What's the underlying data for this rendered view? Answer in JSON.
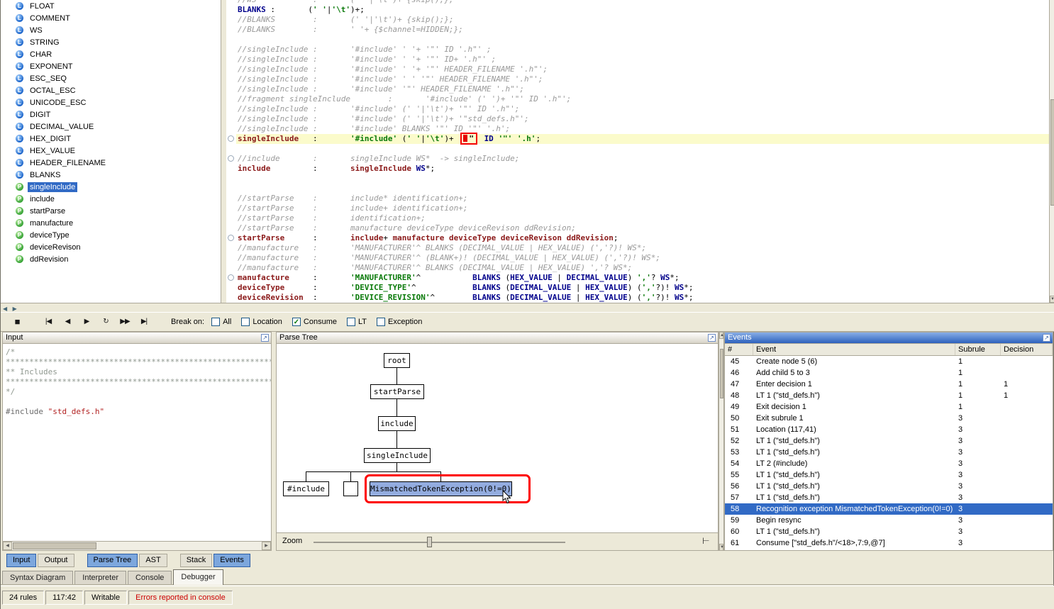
{
  "icons": {
    "detach": "↗",
    "stop": "■",
    "go_to_start": "|◀",
    "step_back": "◀",
    "step_forward": "▶",
    "rewind": "↻",
    "fast_forward": "▶▶",
    "go_to_end": "▶|",
    "check": "✓",
    "scroll_up": "▲",
    "scroll_down": "▼",
    "scroll_left": "◀",
    "scroll_right": "▶",
    "collapse_left": "◀",
    "collapse_right": "▶",
    "tree_layout": "⊢"
  },
  "rules_panel": {
    "items": [
      {
        "name": "FLOAT",
        "kind": "lexer"
      },
      {
        "name": "COMMENT",
        "kind": "lexer"
      },
      {
        "name": "WS",
        "kind": "lexer"
      },
      {
        "name": "STRING",
        "kind": "lexer"
      },
      {
        "name": "CHAR",
        "kind": "lexer"
      },
      {
        "name": "EXPONENT",
        "kind": "lexer"
      },
      {
        "name": "ESC_SEQ",
        "kind": "lexer"
      },
      {
        "name": "OCTAL_ESC",
        "kind": "lexer"
      },
      {
        "name": "UNICODE_ESC",
        "kind": "lexer"
      },
      {
        "name": "DIGIT",
        "kind": "lexer"
      },
      {
        "name": "DECIMAL_VALUE",
        "kind": "lexer"
      },
      {
        "name": "HEX_DIGIT",
        "kind": "lexer"
      },
      {
        "name": "HEX_VALUE",
        "kind": "lexer"
      },
      {
        "name": "HEADER_FILENAME",
        "kind": "lexer"
      },
      {
        "name": "BLANKS",
        "kind": "lexer"
      },
      {
        "name": "singleInclude",
        "kind": "parser",
        "selected": true
      },
      {
        "name": "include",
        "kind": "parser"
      },
      {
        "name": "startParse",
        "kind": "parser"
      },
      {
        "name": "manufacture",
        "kind": "parser"
      },
      {
        "name": "deviceType",
        "kind": "parser"
      },
      {
        "name": "deviceRevison",
        "kind": "parser"
      },
      {
        "name": "ddRevision",
        "kind": "parser"
      }
    ]
  },
  "editor": {
    "lines": [
      {
        "segs": [
          [
            "cmt",
            "//WS            :       (' '|'\\t')+ {skip();};"
          ]
        ]
      },
      {
        "segs": [
          [
            "tok",
            "BLANKS"
          ],
          [
            "pln",
            " :       ("
          ],
          [
            "lit",
            "' '"
          ],
          [
            "pln",
            "|"
          ],
          [
            "lit",
            "'\\t'"
          ],
          [
            "pln",
            ")+;"
          ]
        ]
      },
      {
        "segs": [
          [
            "cmt",
            "//BLANKS        :       (' '|'\\t')+ {skip();};"
          ]
        ]
      },
      {
        "segs": [
          [
            "cmt",
            "//BLANKS        :       ' '+ {$channel=HIDDEN;};"
          ]
        ]
      },
      {
        "segs": []
      },
      {
        "segs": [
          [
            "cmt",
            "//singleInclude :       '#include' ' '+ '\"' ID '.h\"' ;"
          ]
        ]
      },
      {
        "segs": [
          [
            "cmt",
            "//singleInclude :       '#include' ' '+ '\"' ID+ '.h\"' ;"
          ]
        ]
      },
      {
        "segs": [
          [
            "cmt",
            "//singleInclude :       '#include' ' '+ '\"' HEADER_FILENAME '.h\"';"
          ]
        ]
      },
      {
        "segs": [
          [
            "cmt",
            "//singleInclude :       '#include' ' ' '\"' HEADER_FILENAME '.h\"';"
          ]
        ]
      },
      {
        "segs": [
          [
            "cmt",
            "//singleInclude :       '#include' '\"' HEADER_FILENAME '.h\"';"
          ]
        ]
      },
      {
        "segs": [
          [
            "cmt",
            "//fragment singleInclude        :       '#include' (' ')+ '\"' ID '.h\"';"
          ]
        ]
      },
      {
        "segs": [
          [
            "cmt",
            "//singleInclude :       '#include' (' '|'\\t')+ '\"' ID '.h\"';"
          ]
        ]
      },
      {
        "segs": [
          [
            "cmt",
            "//singleInclude :       '#include' (' '|'\\t')+ '\"std_defs.h\"';"
          ]
        ]
      },
      {
        "segs": [
          [
            "cmt",
            "//singleInclude :       '#include' BLANKS '\"' ID '\"' '.h';"
          ]
        ]
      },
      {
        "current": true,
        "segs": [
          [
            "rule",
            "singleInclude"
          ],
          [
            "pln",
            "   :       "
          ],
          [
            "lit",
            "'#include'"
          ],
          [
            "pln",
            " ("
          ],
          [
            "lit",
            "' '"
          ],
          [
            "pln",
            "|"
          ],
          [
            "lit",
            "'\\t'"
          ],
          [
            "pln",
            ")+ "
          ],
          [
            "cur",
            "\""
          ],
          [
            "pln",
            " "
          ],
          [
            "tok",
            "ID"
          ],
          [
            "pln",
            " "
          ],
          [
            "lit",
            "'\"'"
          ],
          [
            "pln",
            " "
          ],
          [
            "lit",
            "'.h'"
          ],
          [
            "pln",
            ";"
          ]
        ]
      },
      {
        "segs": []
      },
      {
        "segs": [
          [
            "cmt",
            "//include       :       singleInclude WS*  -> singleInclude;"
          ]
        ]
      },
      {
        "segs": [
          [
            "rule",
            "include"
          ],
          [
            "pln",
            "         :       "
          ],
          [
            "rule",
            "singleInclude"
          ],
          [
            "pln",
            " "
          ],
          [
            "tok",
            "WS"
          ],
          [
            "pln",
            "*;"
          ]
        ]
      },
      {
        "segs": []
      },
      {
        "segs": []
      },
      {
        "segs": [
          [
            "cmt",
            "//startParse    :       include* identification+;"
          ]
        ]
      },
      {
        "segs": [
          [
            "cmt",
            "//startParse    :       include+ identification+;"
          ]
        ]
      },
      {
        "segs": [
          [
            "cmt",
            "//startParse    :       identification+;"
          ]
        ]
      },
      {
        "segs": [
          [
            "cmt",
            "//startParse    :       manufacture deviceType deviceRevison ddRevision;"
          ]
        ]
      },
      {
        "segs": [
          [
            "rule",
            "startParse"
          ],
          [
            "pln",
            "      :       "
          ],
          [
            "rule",
            "include"
          ],
          [
            "pln",
            "+ "
          ],
          [
            "rule",
            "manufacture"
          ],
          [
            "pln",
            " "
          ],
          [
            "rule",
            "deviceType"
          ],
          [
            "pln",
            " "
          ],
          [
            "rule",
            "deviceRevison"
          ],
          [
            "pln",
            " "
          ],
          [
            "rule",
            "ddRevision"
          ],
          [
            "pln",
            ";"
          ]
        ]
      },
      {
        "segs": [
          [
            "cmt",
            "//manufacture   :       'MANUFACTURER'^ BLANKS (DECIMAL_VALUE | HEX_VALUE) (','?)! WS*;"
          ]
        ]
      },
      {
        "segs": [
          [
            "cmt",
            "//manufacture   :       'MANUFACTURER'^ (BLANK+)! (DECIMAL_VALUE | HEX_VALUE) (','?)! WS*;"
          ]
        ]
      },
      {
        "segs": [
          [
            "cmt",
            "//manufacture   :       'MANUFACTURER'^ BLANKS (DECIMAL_VALUE | HEX_VALUE) ','? WS*;"
          ]
        ]
      },
      {
        "segs": [
          [
            "rule",
            "manufacture"
          ],
          [
            "pln",
            "     :       "
          ],
          [
            "lit",
            "'MANUFACTURER'"
          ],
          [
            "pln",
            "^           "
          ],
          [
            "tok",
            "BLANKS"
          ],
          [
            "pln",
            " ("
          ],
          [
            "tok",
            "HEX_VALUE"
          ],
          [
            "pln",
            " | "
          ],
          [
            "tok",
            "DECIMAL_VALUE"
          ],
          [
            "pln",
            ") "
          ],
          [
            "lit",
            "','"
          ],
          [
            "pln",
            "? "
          ],
          [
            "tok",
            "WS"
          ],
          [
            "pln",
            "*;"
          ]
        ]
      },
      {
        "segs": [
          [
            "rule",
            "deviceType"
          ],
          [
            "pln",
            "      :       "
          ],
          [
            "lit",
            "'DEVICE_TYPE'"
          ],
          [
            "pln",
            "^            "
          ],
          [
            "tok",
            "BLANKS"
          ],
          [
            "pln",
            " ("
          ],
          [
            "tok",
            "DECIMAL_VALUE"
          ],
          [
            "pln",
            " | "
          ],
          [
            "tok",
            "HEX_VALUE"
          ],
          [
            "pln",
            ") ("
          ],
          [
            "lit",
            "','"
          ],
          [
            "pln",
            "?)! "
          ],
          [
            "tok",
            "WS"
          ],
          [
            "pln",
            "*;"
          ]
        ]
      },
      {
        "segs": [
          [
            "rule",
            "deviceRevision"
          ],
          [
            "pln",
            "  :       "
          ],
          [
            "lit",
            "'DEVICE_REVISION'"
          ],
          [
            "pln",
            "^        "
          ],
          [
            "tok",
            "BLANKS"
          ],
          [
            "pln",
            " ("
          ],
          [
            "tok",
            "DECIMAL_VALUE"
          ],
          [
            "pln",
            " | "
          ],
          [
            "tok",
            "HEX_VALUE"
          ],
          [
            "pln",
            ") ("
          ],
          [
            "lit",
            "','"
          ],
          [
            "pln",
            "?)! "
          ],
          [
            "tok",
            "WS"
          ],
          [
            "pln",
            "*;"
          ]
        ]
      }
    ]
  },
  "toolbar": {
    "break_on_label": "Break on:",
    "buttons": [
      {
        "name": "stop",
        "icon": "stop"
      },
      {
        "name": "go-to-start",
        "icon": "go_to_start"
      },
      {
        "name": "step-back",
        "icon": "step_back"
      },
      {
        "name": "step-forward",
        "icon": "step_forward"
      },
      {
        "name": "rewind",
        "icon": "rewind"
      },
      {
        "name": "fast-forward",
        "icon": "fast_forward"
      },
      {
        "name": "go-to-end",
        "icon": "go_to_end"
      }
    ],
    "checkboxes": [
      {
        "label": "All",
        "checked": false
      },
      {
        "label": "Location",
        "checked": false
      },
      {
        "label": "Consume",
        "checked": true
      },
      {
        "label": "LT",
        "checked": false
      },
      {
        "label": "Exception",
        "checked": false
      }
    ]
  },
  "input_panel": {
    "title": "Input",
    "lines": [
      [
        [
          "icmt",
          "/*"
        ]
      ],
      [
        [
          "icmt",
          "**********************************************************************************************"
        ]
      ],
      [
        [
          "icmt",
          "** Includes"
        ]
      ],
      [
        [
          "icmt",
          "**********************************************************************************************"
        ]
      ],
      [
        [
          "icmt",
          "*/"
        ]
      ],
      [],
      [
        [
          "idir",
          "#include"
        ],
        [
          "ipln",
          " "
        ],
        [
          "istr",
          "\"std_defs.h\""
        ]
      ]
    ]
  },
  "parse_tree": {
    "title": "Parse Tree",
    "zoom_label": "Zoom",
    "nodes": {
      "root": "root",
      "start_parse": "startParse",
      "include": "include",
      "single_include": "singleInclude",
      "child_include_literal": "#include",
      "child_empty": "",
      "child_exception": "MismatchedTokenException(0!=0)"
    }
  },
  "events_panel": {
    "title": "Events",
    "columns": [
      "#",
      "Event",
      "Subrule",
      "Decision"
    ],
    "rows": [
      {
        "n": "45",
        "event": "Create node 5 (6)",
        "subrule": "1",
        "decision": ""
      },
      {
        "n": "46",
        "event": "Add child 5 to 3",
        "subrule": "1",
        "decision": ""
      },
      {
        "n": "47",
        "event": "Enter decision 1",
        "subrule": "1",
        "decision": "1"
      },
      {
        "n": "48",
        "event": "LT 1 (\"std_defs.h\")",
        "subrule": "1",
        "decision": "1"
      },
      {
        "n": "49",
        "event": "Exit decision 1",
        "subrule": "1",
        "decision": ""
      },
      {
        "n": "50",
        "event": "Exit subrule 1",
        "subrule": "3",
        "decision": ""
      },
      {
        "n": "51",
        "event": "Location (117,41)",
        "subrule": "3",
        "decision": ""
      },
      {
        "n": "52",
        "event": "LT 1 (\"std_defs.h\")",
        "subrule": "3",
        "decision": ""
      },
      {
        "n": "53",
        "event": "LT 1 (\"std_defs.h\")",
        "subrule": "3",
        "decision": ""
      },
      {
        "n": "54",
        "event": "LT 2 (#include)",
        "subrule": "3",
        "decision": ""
      },
      {
        "n": "55",
        "event": "LT 1 (\"std_defs.h\")",
        "subrule": "3",
        "decision": ""
      },
      {
        "n": "56",
        "event": "LT 1 (\"std_defs.h\")",
        "subrule": "3",
        "decision": ""
      },
      {
        "n": "57",
        "event": "LT 1 (\"std_defs.h\")",
        "subrule": "3",
        "decision": ""
      },
      {
        "n": "58",
        "event": "Recognition exception MismatchedTokenException(0!=0)",
        "subrule": "3",
        "decision": "",
        "selected": true
      },
      {
        "n": "59",
        "event": "Begin resync",
        "subrule": "3",
        "decision": ""
      },
      {
        "n": "60",
        "event": "LT 1 (\"std_defs.h\")",
        "subrule": "3",
        "decision": ""
      },
      {
        "n": "61",
        "event": "Consume [\"std_defs.h\"/<18>,7:9,@7]",
        "subrule": "3",
        "decision": ""
      }
    ]
  },
  "view_tabs": {
    "groups": [
      {
        "tabs": [
          {
            "label": "Input",
            "selected": true
          },
          {
            "label": "Output",
            "selected": false
          }
        ]
      },
      {
        "tabs": [
          {
            "label": "Parse Tree",
            "selected": true
          },
          {
            "label": "AST",
            "selected": false
          }
        ]
      },
      {
        "tabs": [
          {
            "label": "Stack",
            "selected": false
          },
          {
            "label": "Events",
            "selected": true
          }
        ]
      }
    ]
  },
  "main_tabs": {
    "tabs": [
      {
        "label": "Syntax Diagram",
        "selected": false
      },
      {
        "label": "Interpreter",
        "selected": false
      },
      {
        "label": "Console",
        "selected": false
      },
      {
        "label": "Debugger",
        "selected": true
      }
    ]
  },
  "status_bar": {
    "cells": [
      {
        "text": "24 rules"
      },
      {
        "text": "117:42"
      },
      {
        "text": "Writable"
      },
      {
        "text": "Errors reported in console",
        "error": true
      }
    ]
  }
}
